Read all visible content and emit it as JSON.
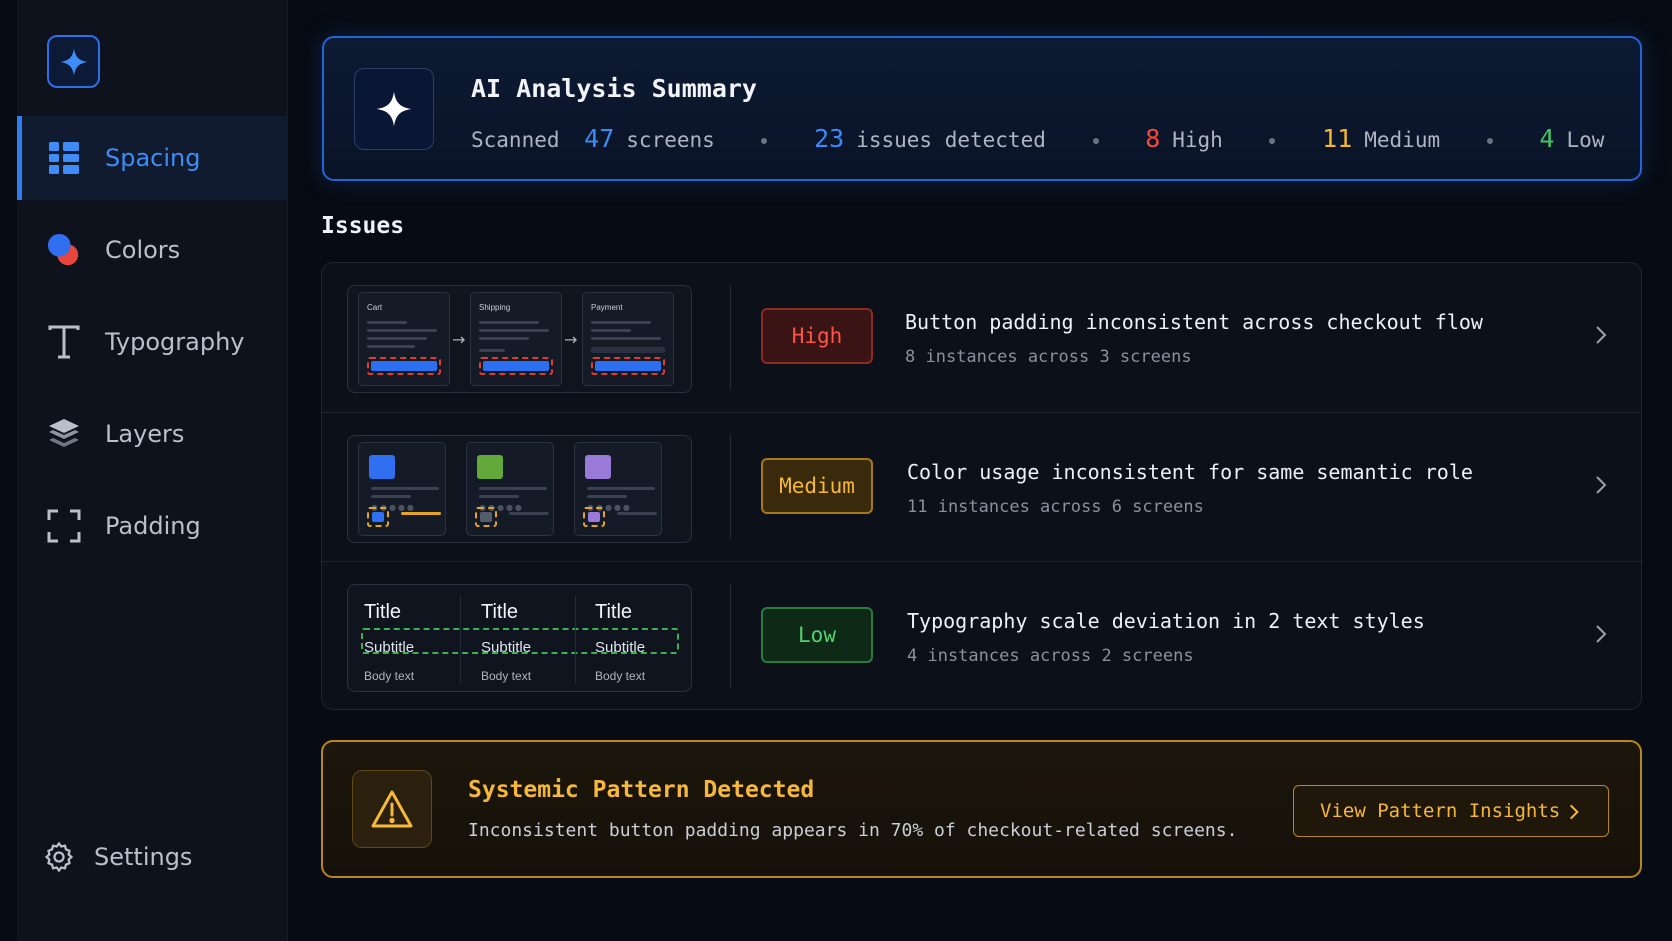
{
  "sidebar": {
    "items": [
      {
        "label": "Spacing",
        "icon": "grid-icon",
        "active": true
      },
      {
        "label": "Colors",
        "icon": "colors-icon"
      },
      {
        "label": "Typography",
        "icon": "typography-icon"
      },
      {
        "label": "Layers",
        "icon": "layers-icon"
      },
      {
        "label": "Padding",
        "icon": "padding-icon"
      }
    ],
    "settings_label": "Settings"
  },
  "summary": {
    "title": "AI Analysis Summary",
    "scanned_prefix": "Scanned",
    "screens_count": "47",
    "screens_label": "screens",
    "issues_count": "23",
    "issues_label": "issues detected",
    "high_count": "8",
    "high_label": "High",
    "medium_count": "11",
    "medium_label": "Medium",
    "low_count": "4",
    "low_label": "Low"
  },
  "issues_heading": "Issues",
  "issues": [
    {
      "severity": "High",
      "title": "Button padding inconsistent across checkout flow",
      "subtitle": "8 instances across 3 screens",
      "thumb_labels": [
        "Cart",
        "Shipping",
        "Payment"
      ]
    },
    {
      "severity": "Medium",
      "title": "Color usage inconsistent for same semantic role",
      "subtitle": "11 instances across 6 screens"
    },
    {
      "severity": "Low",
      "title": "Typography scale deviation in 2 text styles",
      "subtitle": "4 instances across 2 screens",
      "thumb_title": "Title",
      "thumb_subtitle": "Subtitle",
      "thumb_body": "Body text"
    }
  ],
  "pattern": {
    "title": "Systemic Pattern Detected",
    "description": "Inconsistent button padding appears in 70% of checkout-related screens.",
    "button_label": "View Pattern Insights"
  },
  "colors": {
    "accent": "#2f7df3",
    "high": "#f04a3d",
    "medium": "#f5b72c",
    "low": "#44c466"
  }
}
